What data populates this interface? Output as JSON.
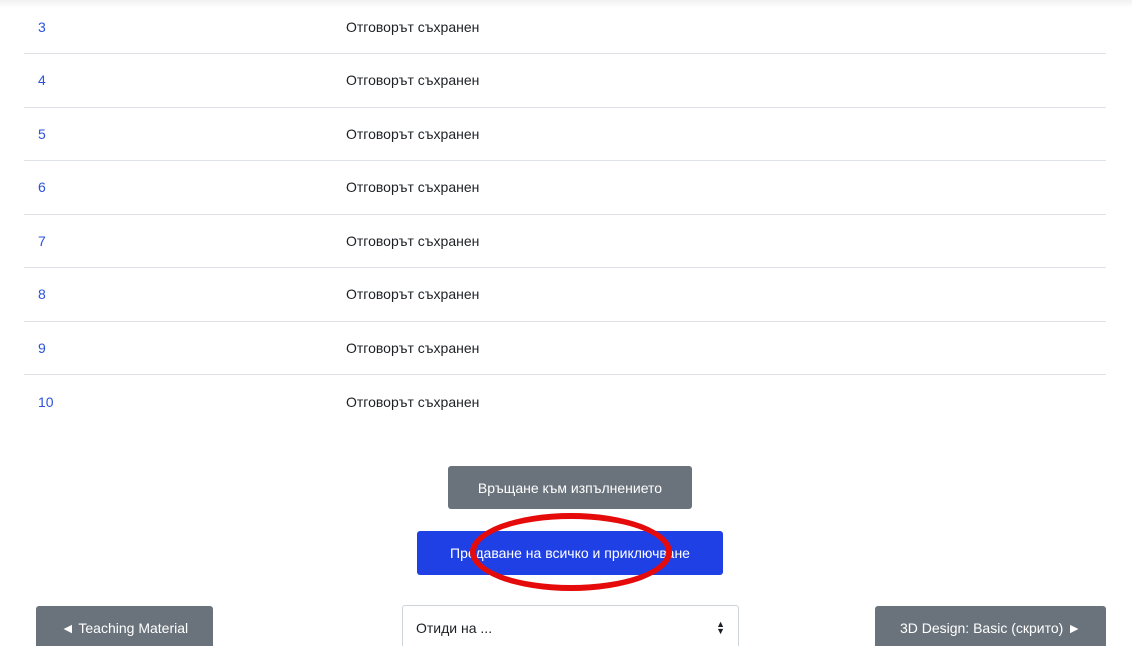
{
  "summary": {
    "rows": [
      {
        "num": "3",
        "status": "Отговорът съхранен"
      },
      {
        "num": "4",
        "status": "Отговорът съхранен"
      },
      {
        "num": "5",
        "status": "Отговорът съхранен"
      },
      {
        "num": "6",
        "status": "Отговорът съхранен"
      },
      {
        "num": "7",
        "status": "Отговорът съхранен"
      },
      {
        "num": "8",
        "status": "Отговорът съхранен"
      },
      {
        "num": "9",
        "status": "Отговорът съхранен"
      },
      {
        "num": "10",
        "status": "Отговорът съхранен"
      }
    ]
  },
  "actions": {
    "return_label": "Връщане към изпълнението",
    "submit_label": "Предаване на всичко и приключване"
  },
  "navigation": {
    "prev_label": "◄ Teaching Material",
    "jump_placeholder": "Отиди на ...",
    "next_label": "3D Design: Basic (скрито) ►"
  },
  "colors": {
    "link": "#2b52d9",
    "primary": "#1f40e5",
    "secondary": "#6a737b",
    "annotation": "#e60b0b"
  },
  "icons": {
    "select_arrow": "select-arrows-icon"
  }
}
